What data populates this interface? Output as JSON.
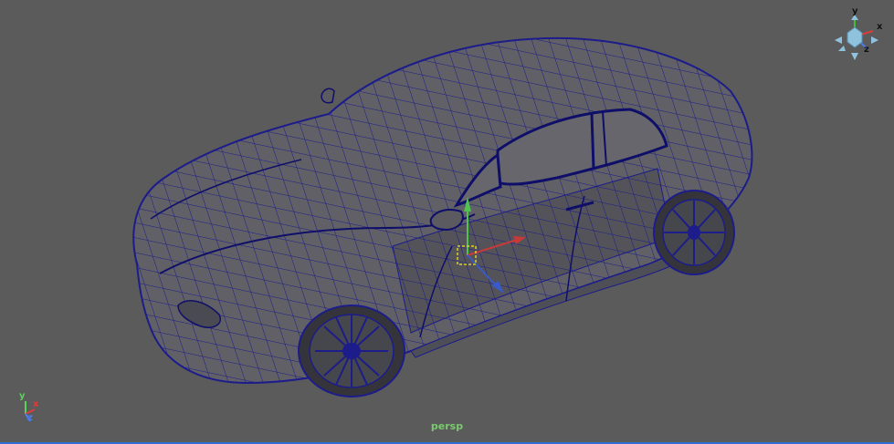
{
  "viewport": {
    "camera_label": "persp",
    "background_color": "#5b5b5b",
    "wireframe_color": "#1c1c8a",
    "selection_color": "#d9d12a"
  },
  "view_cube": {
    "y_label": "y",
    "x_label": "x",
    "z_label": "z",
    "icon": "view-cube-icon"
  },
  "axis_indicator": {
    "y_label": "y",
    "x_label": "x",
    "z_label": "z",
    "colors": {
      "x": "#e03a3a",
      "y": "#57d35a",
      "z": "#4a7df0"
    }
  },
  "model": {
    "icon": "car-wireframe-icon"
  },
  "manipulator": {
    "icon": "move-manipulator-icon"
  }
}
